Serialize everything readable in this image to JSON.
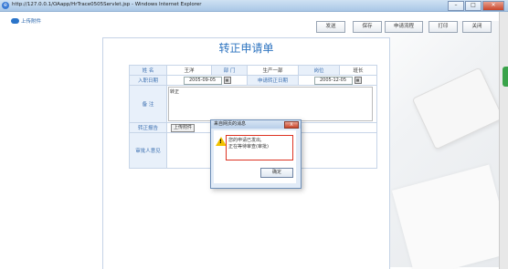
{
  "window": {
    "title": "http://127.0.0.1/OAapp/HrTrace0505Servlet.jsp - Windows Internet Explorer",
    "controls": {
      "minimize": "–",
      "maximize": "□",
      "close": "✕"
    }
  },
  "toolbar": {
    "upload_label": "上传附件",
    "buttons": [
      "发送",
      "保存",
      "申请流程",
      "打印",
      "关闭"
    ]
  },
  "form": {
    "title": "转正申请单",
    "row1": {
      "name_label": "姓 名",
      "name_value": "王洋",
      "dept_label": "部 门",
      "dept_value": "生产一部",
      "pos_label": "岗位",
      "pos_value": "班长"
    },
    "row2": {
      "hire_label": "入职日期",
      "hire_value": "2005-09-05",
      "apply_label": "申请转正日期",
      "apply_value": "2005-12-05"
    },
    "remark_label": "备 注",
    "remark_value": "转正",
    "report_label": "转正报告",
    "attach_button": "上传附件",
    "approver_label": "审批人意见"
  },
  "dialog": {
    "title": "来自网页的消息",
    "message_line1": "您的申请已发出,",
    "message_line2": "正在等待审查(审批)",
    "ok_label": "确定",
    "close_label": "X"
  }
}
